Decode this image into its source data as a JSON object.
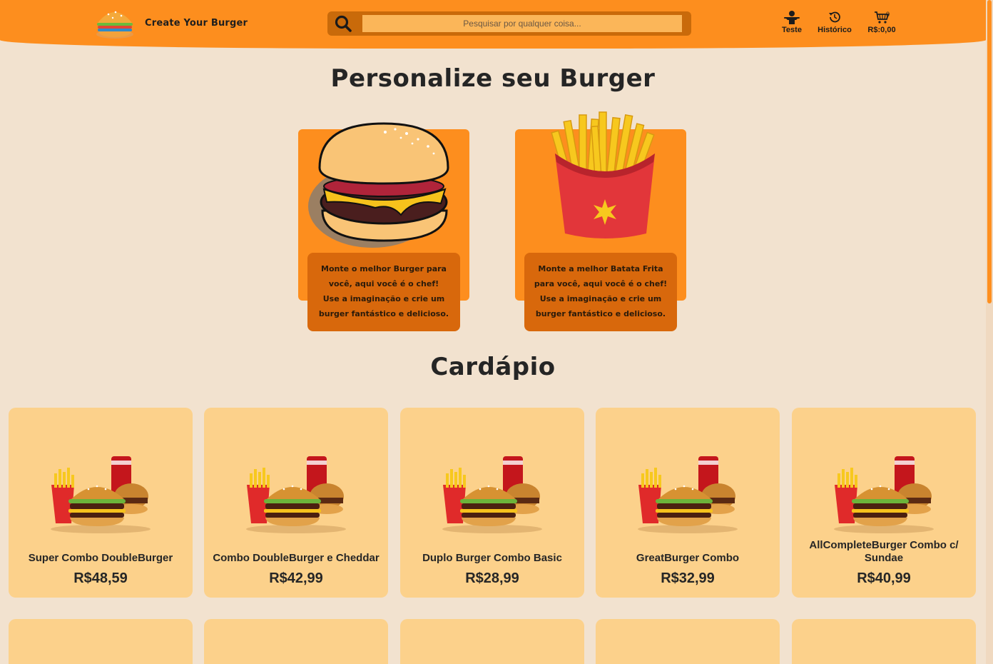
{
  "header": {
    "brand": "Create Your Burger",
    "search_placeholder": "Pesquisar por qualquer coisa...",
    "nav": [
      {
        "label": "Teste",
        "icon": "user-icon"
      },
      {
        "label": "Histórico",
        "icon": "history-icon"
      },
      {
        "label": "R$:0,00",
        "icon": "cart-icon"
      }
    ],
    "cart_count": "0"
  },
  "personalize": {
    "title": "Personalize seu Burger",
    "cards": [
      {
        "icon": "burger-icon",
        "lines": [
          "Monte o melhor Burger para",
          "você, aqui você é o chef!",
          "Use a imaginação e crie um",
          "burger fantástico e delicioso."
        ]
      },
      {
        "icon": "fries-icon",
        "lines": [
          "Monte a melhor Batata Frita",
          "para você, aqui você é o chef!",
          "Use a imaginação e crie um",
          "burger fantástico e delicioso."
        ]
      }
    ]
  },
  "menu": {
    "title": "Cardápio",
    "items": [
      {
        "name": "Super Combo DoubleBurger",
        "price": "R$48,59"
      },
      {
        "name": "Combo DoubleBurger e Cheddar",
        "price": "R$42,99"
      },
      {
        "name": "Duplo Burger Combo Basic",
        "price": "R$28,99"
      },
      {
        "name": "GreatBurger Combo",
        "price": "R$32,99"
      },
      {
        "name": "AllCompleteBurger Combo c/ Sundae",
        "price": "R$40,99"
      }
    ]
  },
  "colors": {
    "header": "#fd8e1e",
    "background": "#f2e2cf",
    "card": "#fcd18b",
    "promo_text_bg": "#d8680c"
  }
}
